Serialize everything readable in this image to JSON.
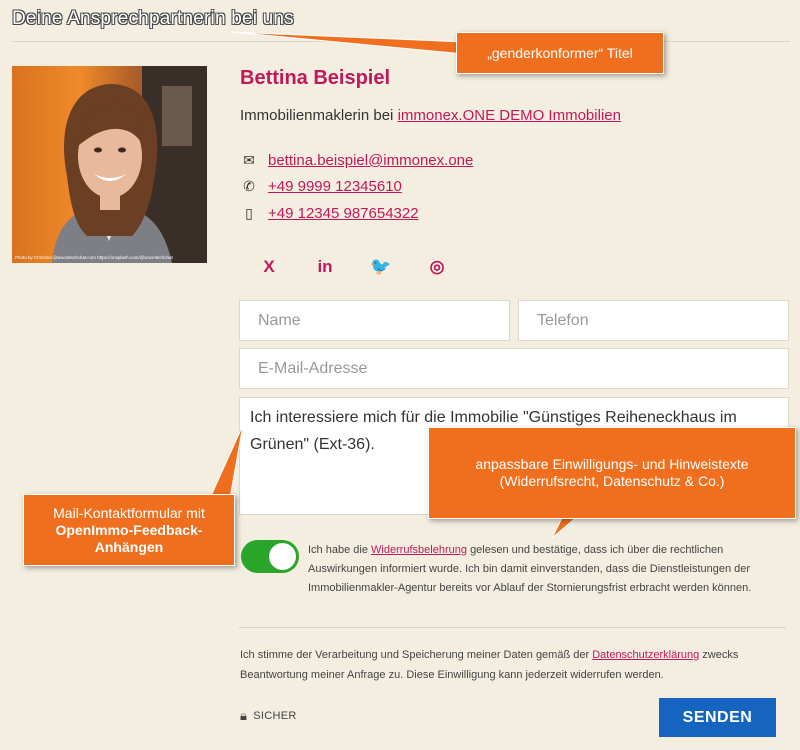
{
  "section": {
    "heading": "Deine Ansprechpartnerin bei uns"
  },
  "agent": {
    "name": "Bettina Beispiel",
    "role_prefix": "Immobilienmaklerin bei",
    "company": "immonex.ONE DEMO Immobilien",
    "photo_credit": "Photo by Christina @wocintechchat.com https://unsplash.com/@wocintechchat",
    "contacts": [
      {
        "icon": "envelope-icon",
        "value": "bettina.beispiel@immonex.one"
      },
      {
        "icon": "phone-icon",
        "value": "+49 9999 12345610"
      },
      {
        "icon": "mobile-icon",
        "value": "+49 12345 987654322"
      }
    ],
    "social": [
      {
        "icon": "xing-icon",
        "glyph": "X"
      },
      {
        "icon": "linkedin-icon",
        "glyph": "in"
      },
      {
        "icon": "twitter-icon",
        "glyph": "🐦"
      },
      {
        "icon": "instagram-icon",
        "glyph": "◎"
      }
    ]
  },
  "form": {
    "name_placeholder": "Name",
    "phone_placeholder": "Telefon",
    "email_placeholder": "E-Mail-Adresse",
    "message_value": "Ich interessiere mich für die Immobilie \"Günstiges Reiheneckhaus im Grünen\" (Ext-36).",
    "consent_before": "Ich habe die",
    "consent_link": "Widerrufsbelehrung",
    "consent_after": "gelesen und bestätige, dass ich über die rechtlichen Auswirkungen informiert wurde. Ich bin damit einverstanden, dass die Dienstleistungen der Immobilienmakler-Agentur bereits vor Ablauf der Stornierungsfrist erbracht werden können.",
    "privacy_before": "Ich stimme der Verarbeitung und Speicherung meiner Daten gemäß der",
    "privacy_link": "Datenschutzerklärung",
    "privacy_after": "zwecks Beantwortung meiner Anfrage zu. Diese Einwilligung kann jederzeit widerrufen werden.",
    "secure_label": "SICHER",
    "send_label": "SENDEN"
  },
  "callouts": {
    "title": "„genderkonformer“ Titel",
    "consent_line1": "anpassbare Einwilligungs- und Hinweistexte",
    "consent_line2": "(Widerrufsrecht, Datenschutz & Co.)",
    "mail_line1": "Mail-Kontaktformular mit",
    "mail_line2": "OpenImmo-Feedback-",
    "mail_line3": "Anhängen"
  },
  "colors": {
    "accent": "#c2185b",
    "background": "#f3eedf",
    "callout": "#ef6f1e",
    "toggle_on": "#2aa52a",
    "button": "#1565c0"
  }
}
